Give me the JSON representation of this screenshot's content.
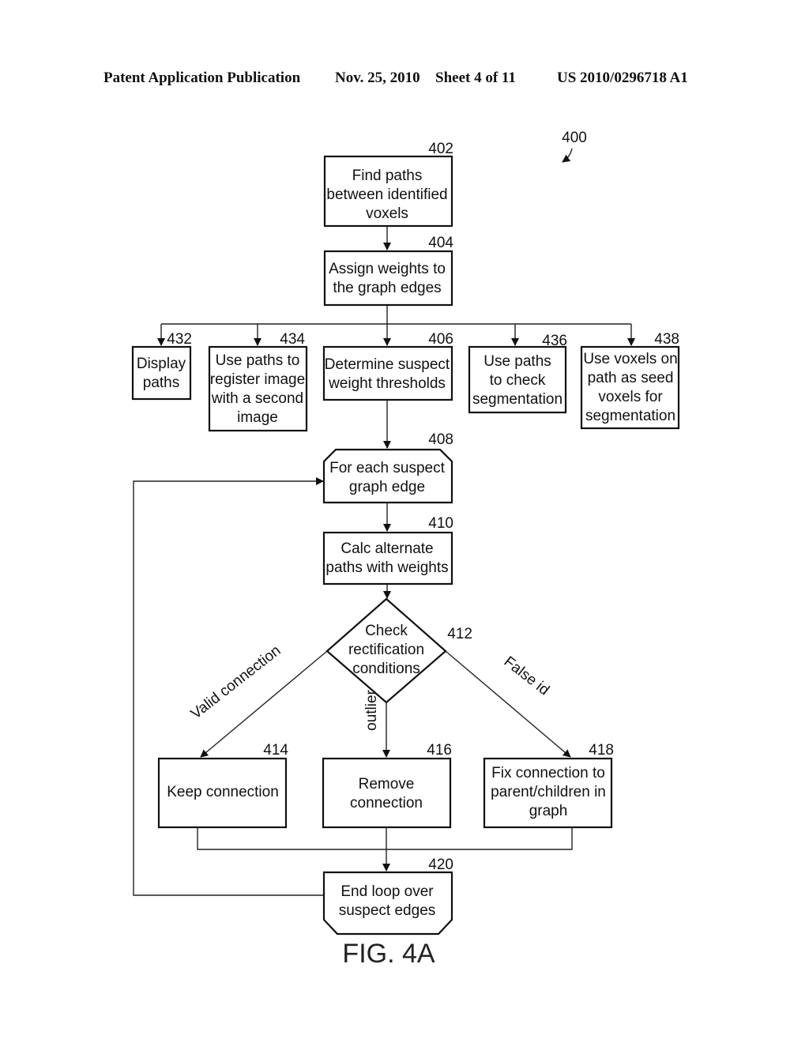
{
  "header": {
    "publication": "Patent Application Publication",
    "date": "Nov. 25, 2010",
    "sheet": "Sheet 4 of 11",
    "number": "US 2010/0296718 A1"
  },
  "figure": {
    "ref": "400",
    "caption": "FIG. 4A"
  },
  "nodes": {
    "n402": {
      "ref": "402",
      "lines": [
        "Find paths",
        "between identified",
        "voxels"
      ]
    },
    "n404": {
      "ref": "404",
      "lines": [
        "Assign weights to",
        "the graph edges"
      ]
    },
    "n432": {
      "ref": "432",
      "lines": [
        "Display",
        "paths"
      ]
    },
    "n434": {
      "ref": "434",
      "lines": [
        "Use paths to",
        "register image",
        "with a second",
        "image"
      ]
    },
    "n406": {
      "ref": "406",
      "lines": [
        "Determine suspect",
        "weight thresholds"
      ]
    },
    "n436": {
      "ref": "436",
      "lines": [
        "Use paths",
        "to check",
        "segmentation"
      ]
    },
    "n438": {
      "ref": "438",
      "lines": [
        "Use voxels on",
        "path as seed",
        "voxels for",
        "segmentation"
      ]
    },
    "n408": {
      "ref": "408",
      "lines": [
        "For each suspect",
        "graph edge"
      ]
    },
    "n410": {
      "ref": "410",
      "lines": [
        "Calc alternate",
        "paths with weights"
      ]
    },
    "n412": {
      "ref": "412",
      "lines": [
        "Check",
        "rectification",
        "conditions"
      ]
    },
    "n414": {
      "ref": "414",
      "lines": [
        "Keep connection"
      ]
    },
    "n416": {
      "ref": "416",
      "lines": [
        "Remove",
        "connection"
      ]
    },
    "n418": {
      "ref": "418",
      "lines": [
        "Fix connection to",
        "parent/children in",
        "graph"
      ]
    },
    "n420": {
      "ref": "420",
      "lines": [
        "End loop over",
        "suspect edges"
      ]
    }
  },
  "edge_labels": {
    "valid": "Valid connection",
    "outlier": "outlier",
    "false_id": "False id"
  }
}
